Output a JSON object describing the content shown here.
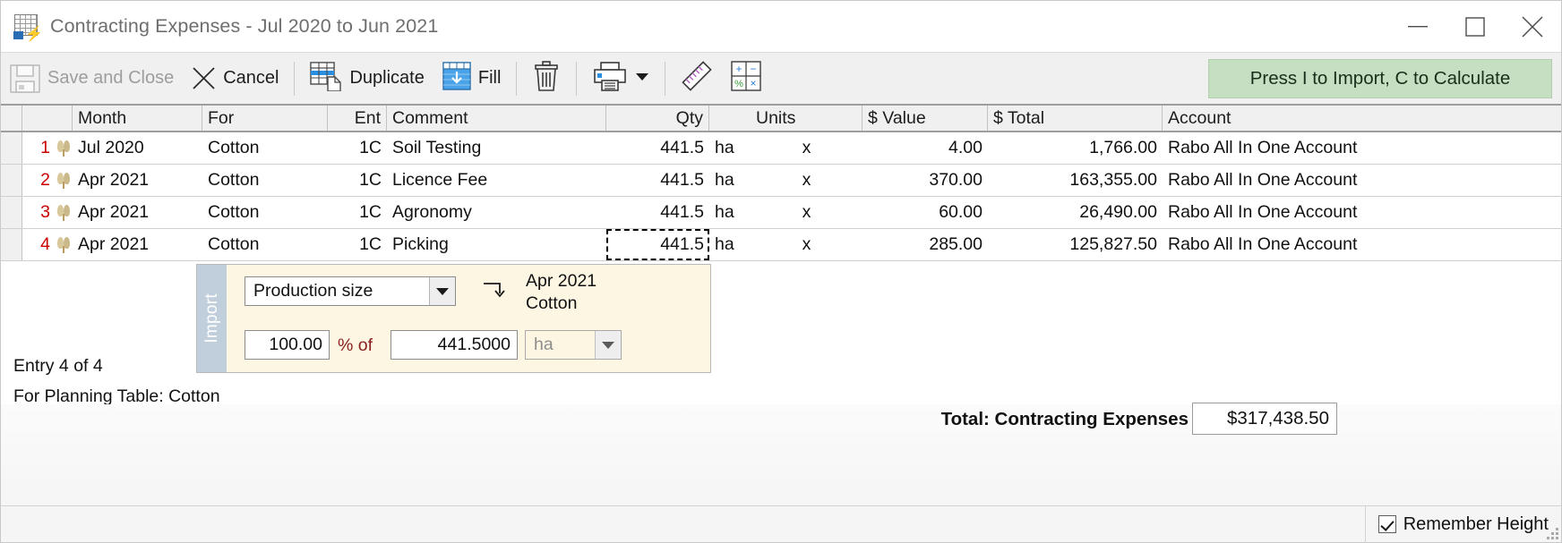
{
  "window": {
    "title": "Contracting Expenses - Jul 2020 to Jun 2021",
    "icon": "spreadsheet-lightning-icon",
    "minimize": "—",
    "maximize": "□",
    "close": "✕"
  },
  "toolbar": {
    "save_and_close": "Save and Close",
    "cancel": "Cancel",
    "duplicate": "Duplicate",
    "fill": "Fill",
    "delete_icon": "trash-icon",
    "print_icon": "printer-icon",
    "print_dropdown": "▼",
    "ruler_icon": "ruler-icon",
    "calculator_icon": "calculator-icon",
    "calculator_glyphs": {
      "plus": "+",
      "minus": "−",
      "percent": "%",
      "times": "×"
    },
    "press_banner": "Press I to Import, C to Calculate",
    "press_banner_color": "#c6dfc2"
  },
  "grid": {
    "columns": [
      {
        "key": "month",
        "label": "Month",
        "align": "left"
      },
      {
        "key": "for",
        "label": "For",
        "align": "left"
      },
      {
        "key": "ent",
        "label": "Ent",
        "align": "right"
      },
      {
        "key": "comment",
        "label": "Comment",
        "align": "left"
      },
      {
        "key": "qty",
        "label": "Qty",
        "align": "right"
      },
      {
        "key": "units",
        "label": "Units",
        "align": "left"
      },
      {
        "key": "value",
        "label": "$ Value",
        "align": "left"
      },
      {
        "key": "total",
        "label": "$ Total",
        "align": "left"
      },
      {
        "key": "account",
        "label": "Account",
        "align": "left"
      }
    ],
    "rows": [
      {
        "num": "1",
        "icon": "cotton-crop-icon",
        "month": "Jul 2020",
        "for": "Cotton",
        "ent": "1C",
        "comment": "Soil Testing",
        "qty": "441.5",
        "unit": "ha",
        "op": "x",
        "value": "4.00",
        "total": "1,766.00",
        "account": "Rabo All In One Account",
        "focus": false
      },
      {
        "num": "2",
        "icon": "cotton-crop-icon",
        "month": "Apr 2021",
        "for": "Cotton",
        "ent": "1C",
        "comment": "Licence Fee",
        "qty": "441.5",
        "unit": "ha",
        "op": "x",
        "value": "370.00",
        "total": "163,355.00",
        "account": "Rabo All In One Account",
        "focus": false
      },
      {
        "num": "3",
        "icon": "cotton-crop-icon",
        "month": "Apr 2021",
        "for": "Cotton",
        "ent": "1C",
        "comment": "Agronomy",
        "qty": "441.5",
        "unit": "ha",
        "op": "x",
        "value": "60.00",
        "total": "26,490.00",
        "account": "Rabo All In One Account",
        "focus": false
      },
      {
        "num": "4",
        "icon": "cotton-crop-icon",
        "month": "Apr 2021",
        "for": "Cotton",
        "ent": "1C",
        "comment": "Picking",
        "qty": "441.5",
        "unit": "ha",
        "op": "x",
        "value": "285.00",
        "total": "125,827.50",
        "account": "Rabo All In One Account",
        "focus": true
      }
    ]
  },
  "import_panel": {
    "tab_label": "Import",
    "source_select": "Production size",
    "source_caret": "▼",
    "link_icon": "arrow-hook-icon",
    "ref_month": "Apr 2021",
    "ref_for": "Cotton",
    "percent_value": "100.00",
    "percent_of_label": "% of",
    "percent_of_color": "#8a2020",
    "quantity_value": "441.5000",
    "unit_placeholder": "ha",
    "unit_caret": "▼",
    "background_color": "#fdf6e3"
  },
  "status": {
    "entry_counter": "Entry 4 of 4",
    "planning_table": "For Planning Table: Cotton"
  },
  "footer": {
    "total_label": "Total: Contracting Expenses",
    "total_value": "$317,438.50",
    "remember_height_label": "Remember Height",
    "remember_height_checked": true
  }
}
